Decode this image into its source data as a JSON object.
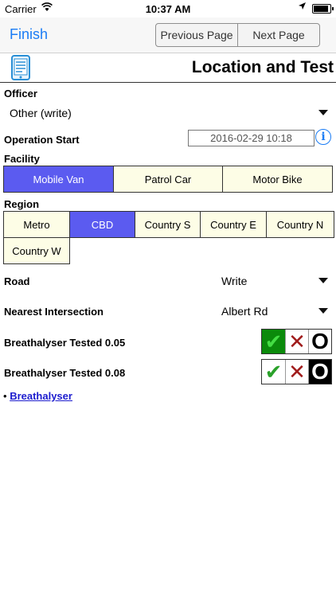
{
  "status_bar": {
    "carrier": "Carrier",
    "time": "10:37 AM"
  },
  "nav": {
    "finish": "Finish",
    "previous": "Previous Page",
    "next": "Next Page"
  },
  "header": {
    "title": "Location and Test"
  },
  "officer": {
    "label": "Officer",
    "value": "Other (write)"
  },
  "operation_start": {
    "label": "Operation Start",
    "value": "2016-02-29 10:18"
  },
  "facility": {
    "label": "Facility",
    "options": [
      "Mobile Van",
      "Patrol Car",
      "Motor Bike"
    ],
    "selected": "Mobile Van"
  },
  "region": {
    "label": "Region",
    "options": [
      "Metro",
      "CBD",
      "Country S",
      "Country E",
      "Country N",
      "Country W"
    ],
    "selected": "CBD"
  },
  "road": {
    "label": "Road",
    "value": "Write"
  },
  "nearest_intersection": {
    "label": "Nearest Intersection",
    "value": "Albert Rd"
  },
  "breath_005": {
    "label": "Breathalyser Tested 0.05",
    "state": "yes"
  },
  "breath_008": {
    "label": "Breathalyser Tested 0.08",
    "state": "not-set"
  },
  "links": {
    "bullet": "•",
    "breathalyser": "Breathalyser"
  },
  "colors": {
    "accent": "#1a7cf5",
    "selected": "#5b5bf0",
    "option_bg": "#fdfde6",
    "check_on": "#0b8a0b"
  }
}
